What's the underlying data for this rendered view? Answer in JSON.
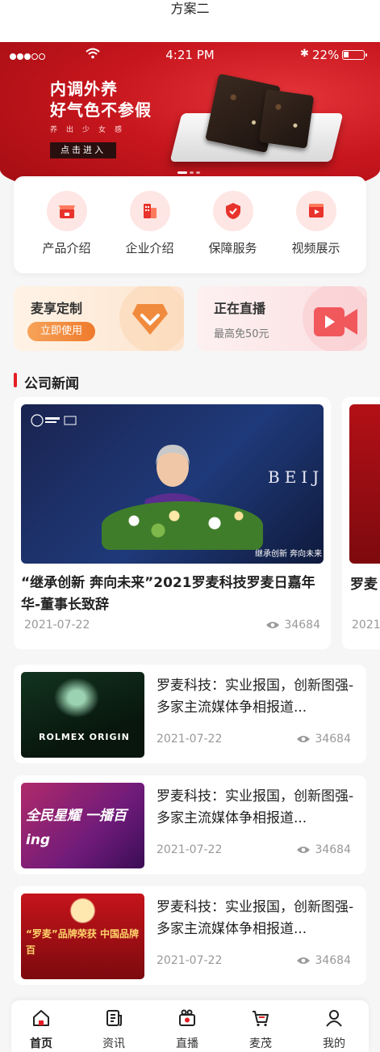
{
  "caption": "方案二",
  "status_bar": {
    "time": "4:21 PM",
    "battery": "22%"
  },
  "banner": {
    "title_line1": "内调外养",
    "title_line2": "好气色不参假",
    "subtitle": "养出少女感",
    "cta": "点击进入",
    "slide_count": 3,
    "active_slide": 1
  },
  "quick_menu": [
    {
      "label": "产品介绍",
      "icon": "store-icon"
    },
    {
      "label": "企业介绍",
      "icon": "building-icon"
    },
    {
      "label": "保障服务",
      "icon": "shield-icon"
    },
    {
      "label": "视频展示",
      "icon": "video-icon"
    }
  ],
  "promos": {
    "custom": {
      "title": "麦享定制",
      "button": "立即使用",
      "icon": "voucher-icon"
    },
    "live": {
      "title": "正在直播",
      "subtitle": "最高免50元",
      "icon": "camera-icon"
    }
  },
  "section": {
    "title": "公司新闻"
  },
  "featured": {
    "title": "“继承创新 奔向未来”2021罗麦科技罗麦日嘉年华-董事长致辞",
    "date": "2021-07-22",
    "views": "34684",
    "image_text": {
      "beij": "BEIJ",
      "caption": "继承创新 奔向未来"
    }
  },
  "featured_peek": {
    "title": "罗麦",
    "date": "2021"
  },
  "news": [
    {
      "title": "罗麦科技：实业报国，创新图强-多家主流媒体争相报道...",
      "date": "2021-07-22",
      "views": "34684",
      "image_text": "ROLMEX ORIGIN"
    },
    {
      "title": "罗麦科技：实业报国，创新图强-多家主流媒体争相报道...",
      "date": "2021-07-22",
      "views": "34684",
      "image_text": "全民星耀 一播百ing"
    },
    {
      "title": "罗麦科技：实业报国，创新图强-多家主流媒体争相报道...",
      "date": "2021-07-22",
      "views": "34684",
      "image_text": "“罗麦”品牌荣获 中国品牌百"
    }
  ],
  "tabs": [
    {
      "label": "首页",
      "icon": "home-icon",
      "active": true
    },
    {
      "label": "资讯",
      "icon": "news-icon",
      "active": false
    },
    {
      "label": "直播",
      "icon": "live-camera-icon",
      "active": false
    },
    {
      "label": "麦茂",
      "icon": "cart-icon",
      "active": false
    },
    {
      "label": "我的",
      "icon": "user-icon",
      "active": false
    }
  ],
  "colors": {
    "accent": "#e41d23",
    "banner": "#c7161d",
    "orange": "#ee7a2b"
  }
}
